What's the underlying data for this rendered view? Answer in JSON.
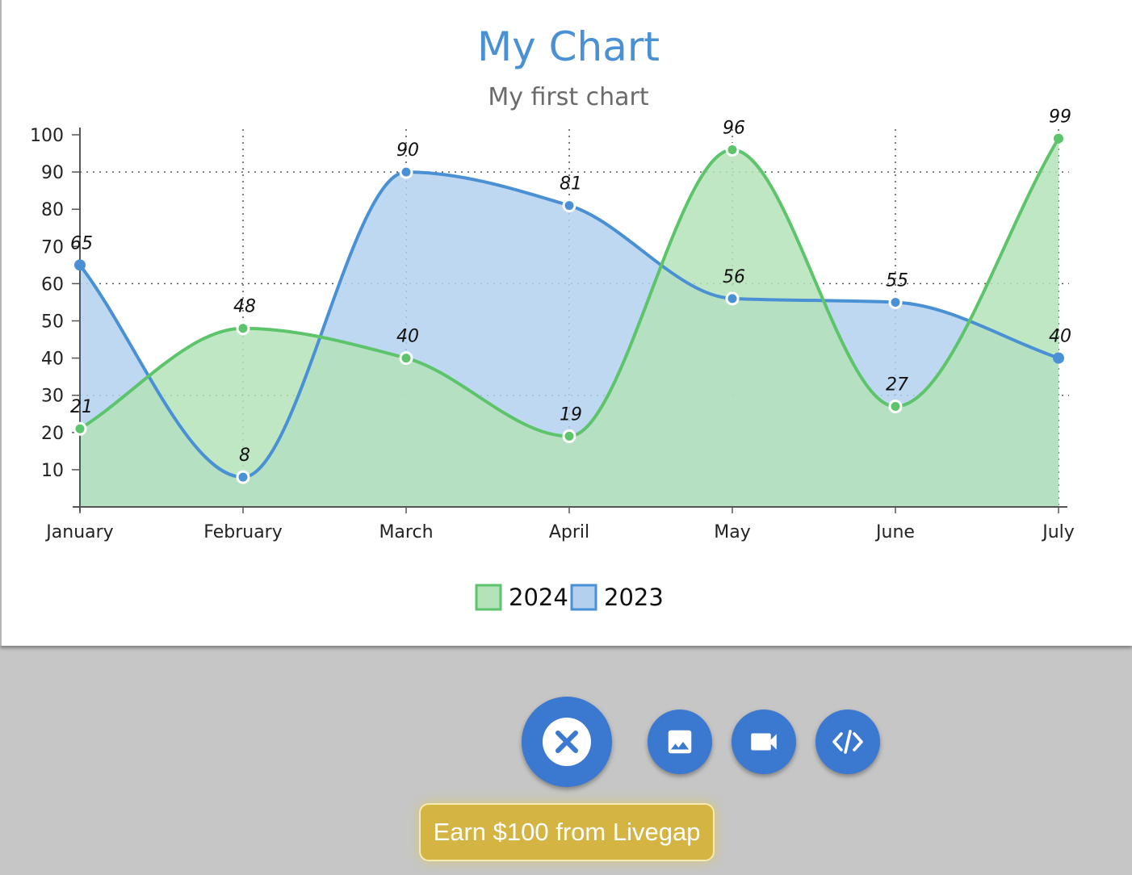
{
  "chart_data": {
    "type": "area",
    "title": "My Chart",
    "subtitle": "My first chart",
    "categories": [
      "January",
      "February",
      "March",
      "April",
      "May",
      "June",
      "July"
    ],
    "series": [
      {
        "name": "2024",
        "values": [
          21,
          48,
          40,
          19,
          96,
          27,
          99
        ],
        "color": "#5dc46b",
        "fill": "#b4e3ba"
      },
      {
        "name": "2023",
        "values": [
          65,
          8,
          90,
          81,
          56,
          55,
          40
        ],
        "color": "#4a90d4",
        "fill": "#b3d1ee"
      }
    ],
    "ylim": [
      0,
      100
    ],
    "yticks": [
      10,
      20,
      30,
      40,
      50,
      60,
      70,
      80,
      90,
      100
    ],
    "grid": "dotted",
    "curve": "smooth",
    "data_labels": true,
    "legend_position": "bottom-center"
  },
  "toolbar": {
    "close_icon": "close-icon",
    "image_icon": "image-icon",
    "video_icon": "video-camera-icon",
    "code_icon": "code-icon",
    "accent_color": "#3b78cf",
    "earn_label": "Earn $100 from Livegap"
  }
}
